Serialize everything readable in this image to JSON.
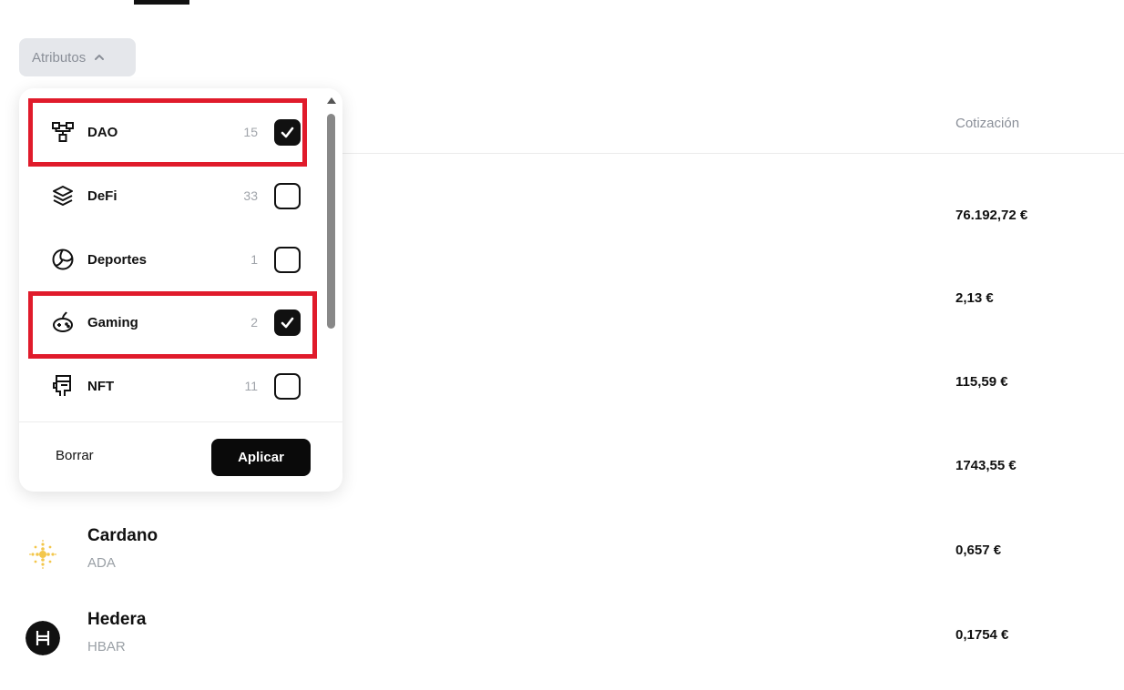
{
  "filter": {
    "button_label": "Atributos",
    "options": [
      {
        "label": "DAO",
        "count": "15",
        "checked": true,
        "icon": "dao-network-icon"
      },
      {
        "label": "DeFi",
        "count": "33",
        "checked": false,
        "icon": "layers-icon"
      },
      {
        "label": "Deportes",
        "count": "1",
        "checked": false,
        "icon": "volleyball-icon"
      },
      {
        "label": "Gaming",
        "count": "2",
        "checked": true,
        "icon": "gamepad-icon"
      },
      {
        "label": "NFT",
        "count": "11",
        "checked": false,
        "icon": "nft-ape-icon"
      }
    ],
    "clear_label": "Borrar",
    "apply_label": "Aplicar"
  },
  "table": {
    "price_header": "Cotización",
    "prices": [
      "76.192,72 €",
      "2,13 €",
      "115,59 €",
      "1743,55 €"
    ],
    "coins": [
      {
        "name": "Cardano",
        "ticker": "ADA",
        "price": "0,657 €",
        "icon": "cardano-icon"
      },
      {
        "name": "Hedera",
        "ticker": "HBAR",
        "price": "0,1754 €",
        "icon": "hedera-icon"
      }
    ]
  },
  "colors": {
    "highlight": "#e01b2b",
    "checked_box": "#111111",
    "apply_button": "#0a0a0a"
  }
}
